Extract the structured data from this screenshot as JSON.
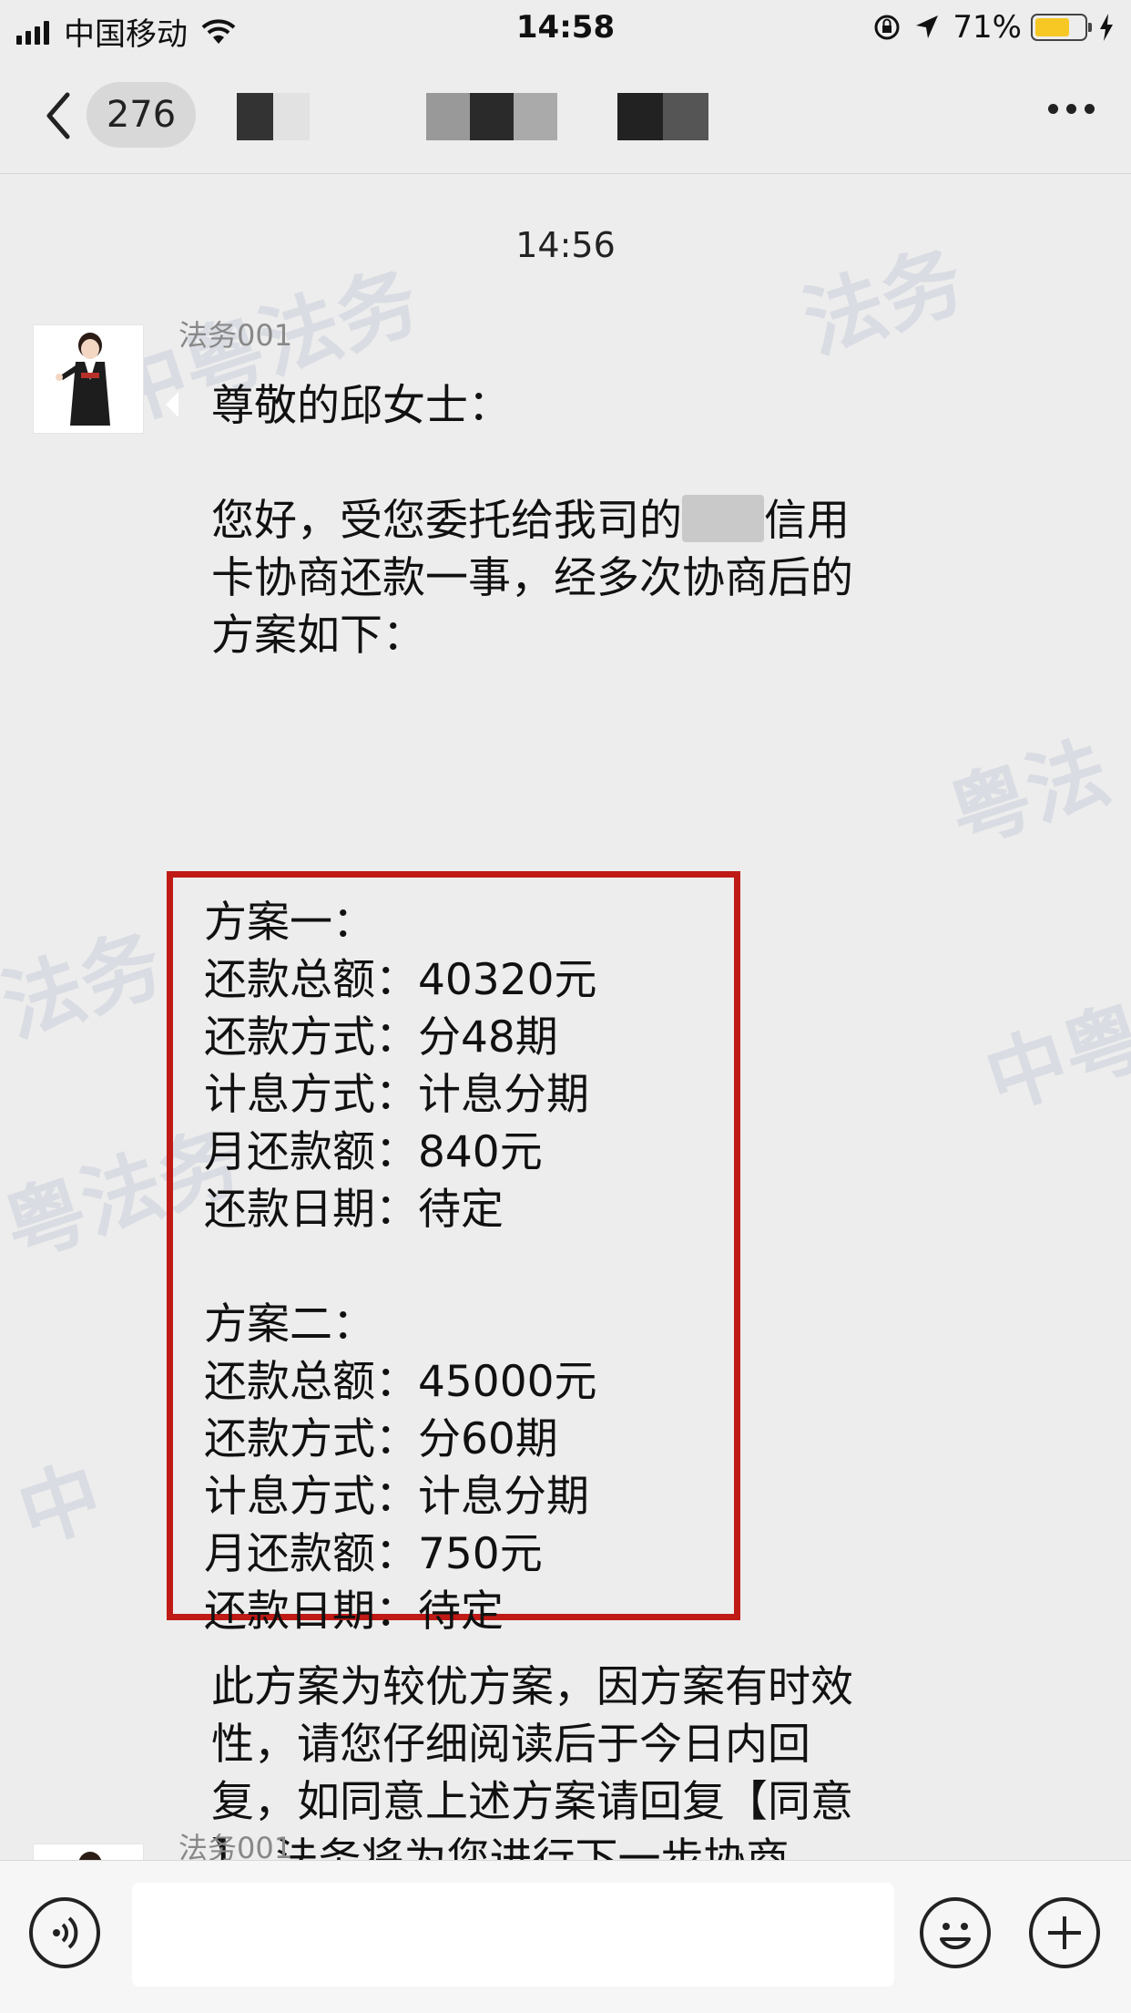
{
  "status_bar": {
    "carrier": "中国移动",
    "time": "14:58",
    "battery": "71%",
    "battery_level": 0.71
  },
  "nav": {
    "unread_count": "276"
  },
  "chat": {
    "timestamp": "14:56",
    "watermark_text": [
      "中粤法务",
      "法务",
      "粤法",
      "中粤",
      "法务",
      "粤法务",
      "中"
    ],
    "sender_name": "法务001",
    "message": {
      "greeting": "尊敬的邱女士：",
      "intro_line1": "您好，受您委托给我司的",
      "intro_line1_end": "信用",
      "intro_line2": "卡协商还款一事，经多次协商后的",
      "intro_line3": "方案如下：",
      "plans": [
        {
          "title": "方案一：",
          "rows": [
            "还款总额：40320元",
            "还款方式：分48期",
            "计息方式：计息分期",
            "月还款额：840元",
            "还款日期：待定"
          ]
        },
        {
          "title": "方案二：",
          "rows": [
            "还款总额：45000元",
            "还款方式：分60期",
            "计息方式：计息分期",
            "月还款额：750元",
            "还款日期：待定"
          ]
        }
      ],
      "closing": [
        "此方案为较优方案，因方案有时效",
        "性，请您仔细阅读后于今日内回",
        "复，如同意上述方案请回复【同意",
        "】，法务将为您进行下一步协商。"
      ]
    },
    "next_sender_name": "法务001"
  },
  "colors": {
    "highlight_border": "#c01a17",
    "background": "#ededed",
    "bubble": "#ffffff"
  }
}
